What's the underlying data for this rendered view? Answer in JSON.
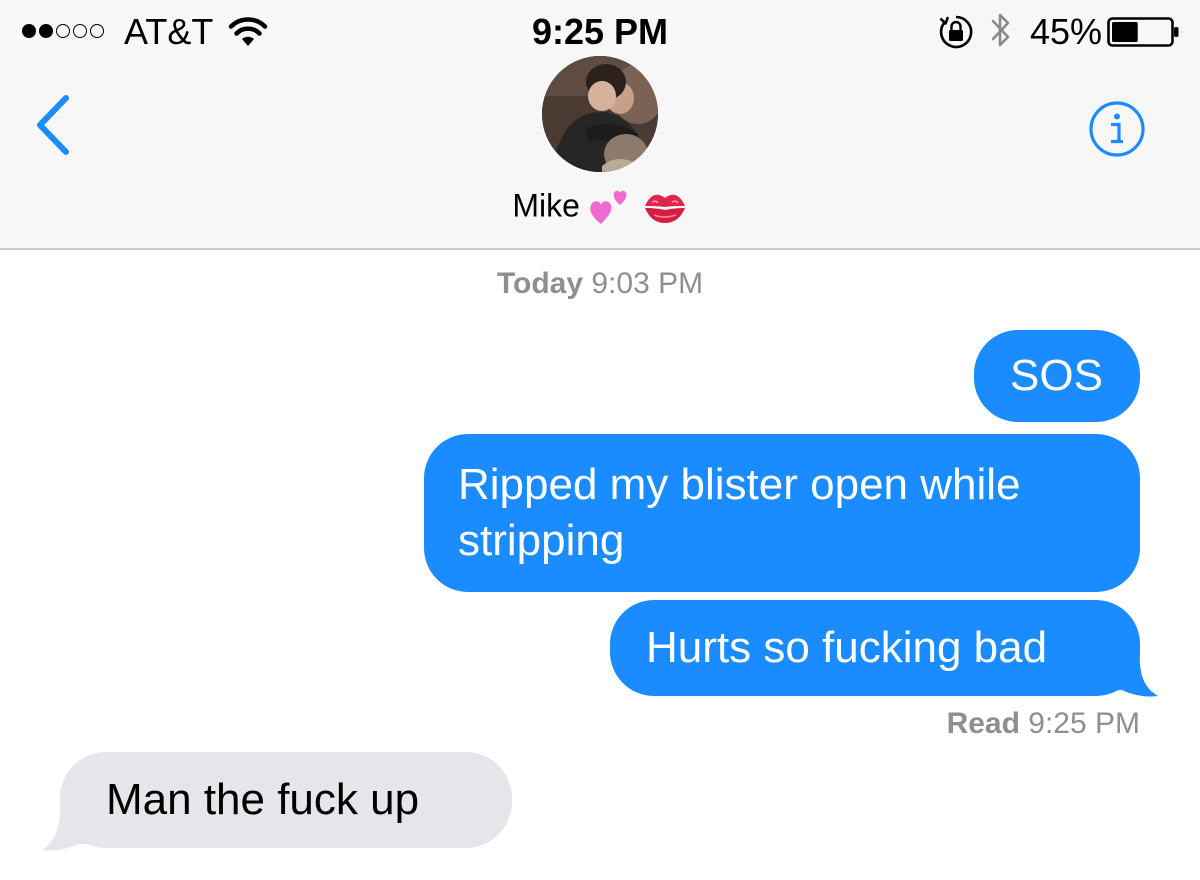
{
  "status_bar": {
    "signal_dots": {
      "filled": 2,
      "total": 5
    },
    "carrier": "AT&T",
    "time": "9:25 PM",
    "battery_percent": "45%",
    "battery_level": 0.45,
    "icons": [
      "wifi-icon",
      "orientation-lock-icon",
      "bluetooth-icon",
      "battery-icon"
    ]
  },
  "nav": {
    "back_icon": "chevron-left-icon",
    "info_icon": "info-icon",
    "contact_name": "Mike",
    "contact_emoji": [
      "two-hearts-emoji",
      "kiss-mark-emoji"
    ]
  },
  "thread": {
    "timestamp_top": {
      "label": "Today",
      "time": "9:03 PM"
    },
    "messages": [
      {
        "direction": "sent",
        "text": "SOS"
      },
      {
        "direction": "sent",
        "text": "Ripped my blister open while stripping"
      },
      {
        "direction": "sent",
        "text": "Hurts so fucking bad"
      },
      {
        "direction": "received",
        "text": "Man the fuck up"
      }
    ],
    "read_receipt": {
      "label": "Read",
      "time": "9:25 PM"
    }
  },
  "colors": {
    "accent": "#1a8cff",
    "sent_bubble": "#1a8cff",
    "received_bubble": "#e5e5ea",
    "meta_text": "#8e8e93",
    "header_bg": "#f7f7f7"
  }
}
